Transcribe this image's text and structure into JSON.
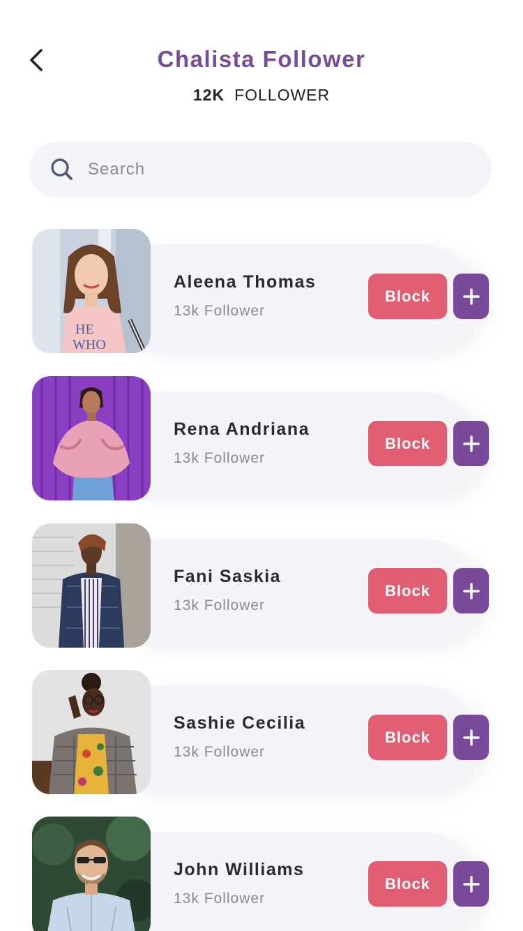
{
  "header": {
    "title": "Chalista Follower",
    "follower_count": "12K",
    "follower_label": "FOLLOWER"
  },
  "search": {
    "placeholder": "Search",
    "value": ""
  },
  "colors": {
    "accent": "#7a4a9a",
    "block": "#e05d72",
    "card": "#f4f4f9"
  },
  "followers": [
    {
      "name": "Aleena Thomas",
      "followers": "13k Follower",
      "block_label": "Block",
      "photo": "woman-pink-tshirt-photo"
    },
    {
      "name": "Rena Andriana",
      "followers": "13k Follower",
      "block_label": "Block",
      "photo": "woman-purple-wall-photo"
    },
    {
      "name": "Fani Saskia",
      "followers": "13k Follower",
      "block_label": "Block",
      "photo": "woman-blazer-brick-wall-photo"
    },
    {
      "name": "Sashie Cecilia",
      "followers": "13k Follower",
      "block_label": "Block",
      "photo": "woman-glasses-plaid-jacket-photo"
    },
    {
      "name": "John Williams",
      "followers": "13k Follower",
      "block_label": "Block",
      "photo": "man-sunglasses-photo"
    }
  ]
}
